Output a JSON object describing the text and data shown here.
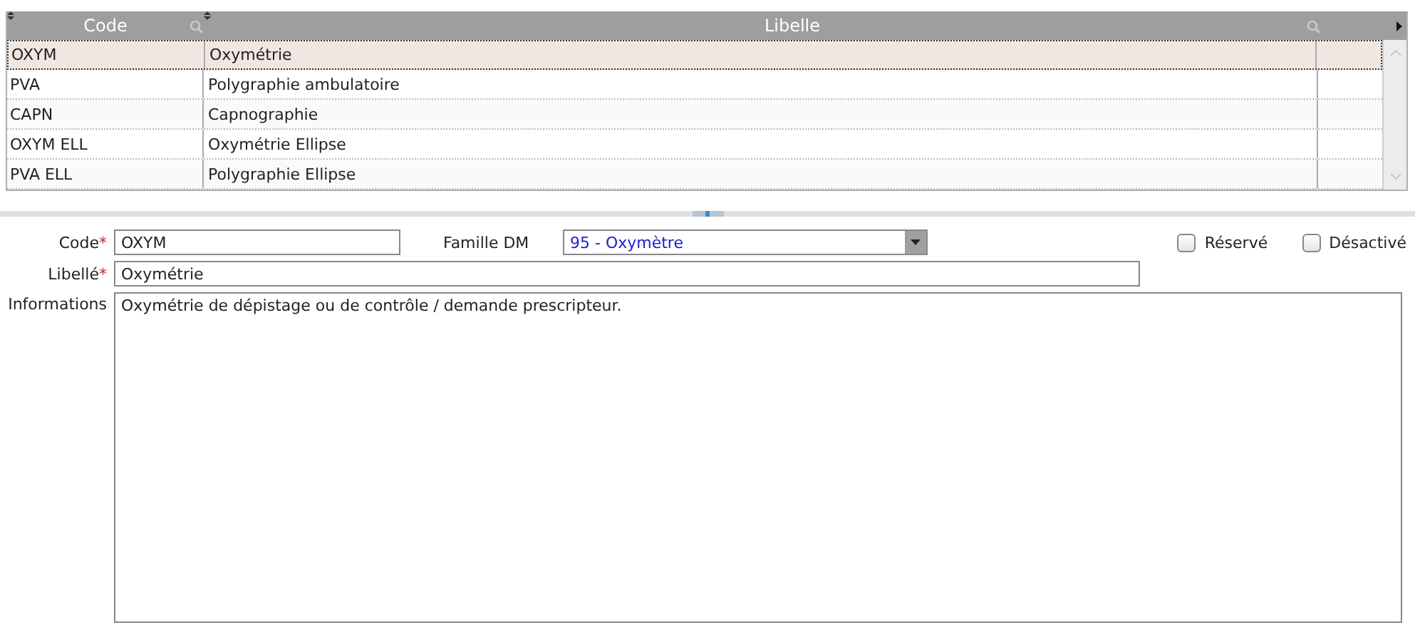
{
  "table": {
    "columns": [
      {
        "label": "Code"
      },
      {
        "label": "Libelle"
      }
    ],
    "rows": [
      {
        "code": "OXYM",
        "libelle": "Oxymétrie",
        "selected": true
      },
      {
        "code": "PVA",
        "libelle": "Polygraphie ambulatoire",
        "selected": false
      },
      {
        "code": "CAPN",
        "libelle": "Capnographie",
        "selected": false
      },
      {
        "code": "OXYM ELL",
        "libelle": "Oxymétrie Ellipse",
        "selected": false
      },
      {
        "code": "PVA ELL",
        "libelle": "Polygraphie Ellipse",
        "selected": false
      }
    ]
  },
  "form": {
    "code": {
      "label": "Code",
      "required_mark": "*",
      "value": "OXYM"
    },
    "famille": {
      "label": "Famille DM",
      "value": "95 - Oxymètre"
    },
    "checkboxes": [
      {
        "label": "Réservé",
        "checked": false
      },
      {
        "label": "Désactivé",
        "checked": false
      }
    ],
    "libelle": {
      "label": "Libellé",
      "required_mark": "*",
      "value": "Oxymétrie"
    },
    "informations": {
      "label": "Informations",
      "value": "Oxymétrie de dépistage ou de contrôle / demande prescripteur."
    }
  }
}
